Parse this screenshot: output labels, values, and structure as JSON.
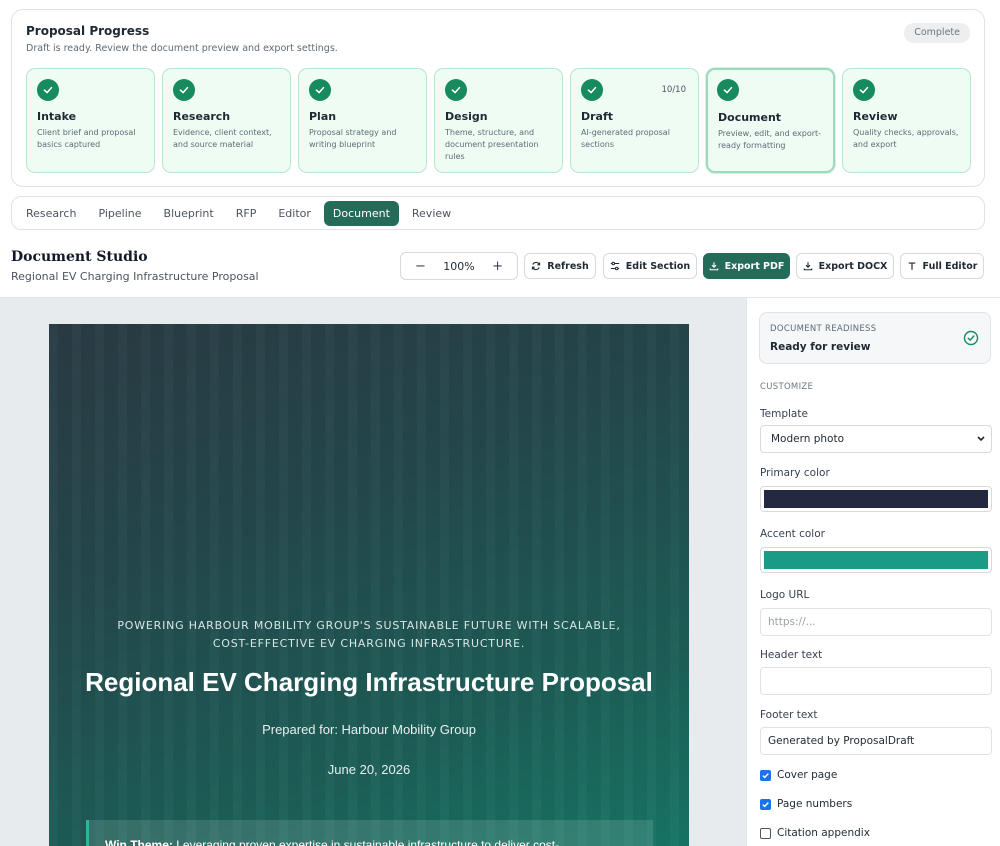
{
  "progress": {
    "title": "Proposal Progress",
    "subtitle": "Draft is ready. Review the document preview and export settings.",
    "badge": "Complete",
    "steps": [
      {
        "name": "Intake",
        "desc": "Client brief and proposal basics captured",
        "count": ""
      },
      {
        "name": "Research",
        "desc": "Evidence, client context, and source material",
        "count": ""
      },
      {
        "name": "Plan",
        "desc": "Proposal strategy and writing blueprint",
        "count": ""
      },
      {
        "name": "Design",
        "desc": "Theme, structure, and document presentation rules",
        "count": ""
      },
      {
        "name": "Draft",
        "desc": "AI-generated proposal sections",
        "count": "10/10"
      },
      {
        "name": "Document",
        "desc": "Preview, edit, and export-ready formatting",
        "count": ""
      },
      {
        "name": "Review",
        "desc": "Quality checks, approvals, and export",
        "count": ""
      }
    ]
  },
  "tabs": [
    "Research",
    "Pipeline",
    "Blueprint",
    "RFP",
    "Editor",
    "Document",
    "Review"
  ],
  "studio": {
    "title": "Document Studio",
    "subtitle": "Regional EV Charging Infrastructure Proposal",
    "zoom": "100%",
    "zoom_minus": "−",
    "zoom_plus": "+",
    "buttons": {
      "refresh": "Refresh",
      "edit_section": "Edit Section",
      "export_pdf": "Export PDF",
      "export_docx": "Export DOCX",
      "full_editor": "Full Editor"
    }
  },
  "document": {
    "tagline": "POWERING HARBOUR MOBILITY GROUP'S SUSTAINABLE FUTURE WITH SCALABLE, COST-EFFECTIVE EV CHARGING INFRASTRUCTURE.",
    "title": "Regional EV Charging Infrastructure Proposal",
    "prepared_for": "Prepared for: Harbour Mobility Group",
    "date": "June 20, 2026",
    "win_label": "Win Theme:",
    "win_text": " Leveraging proven expertise in sustainable infrastructure to deliver cost-"
  },
  "panel": {
    "readiness_label": "DOCUMENT READINESS",
    "readiness_value": "Ready for review",
    "customize": "CUSTOMIZE",
    "template_label": "Template",
    "template_value": "Modern photo",
    "primary_label": "Primary color",
    "primary_color": "#232a3f",
    "accent_label": "Accent color",
    "accent_color": "#1a9b85",
    "logo_label": "Logo URL",
    "logo_placeholder": "https://...",
    "header_label": "Header text",
    "header_value": "",
    "footer_label": "Footer text",
    "footer_value": "Generated by ProposalDraft",
    "cover_page": "Cover page",
    "page_numbers": "Page numbers",
    "citation_appendix": "Citation appendix"
  }
}
